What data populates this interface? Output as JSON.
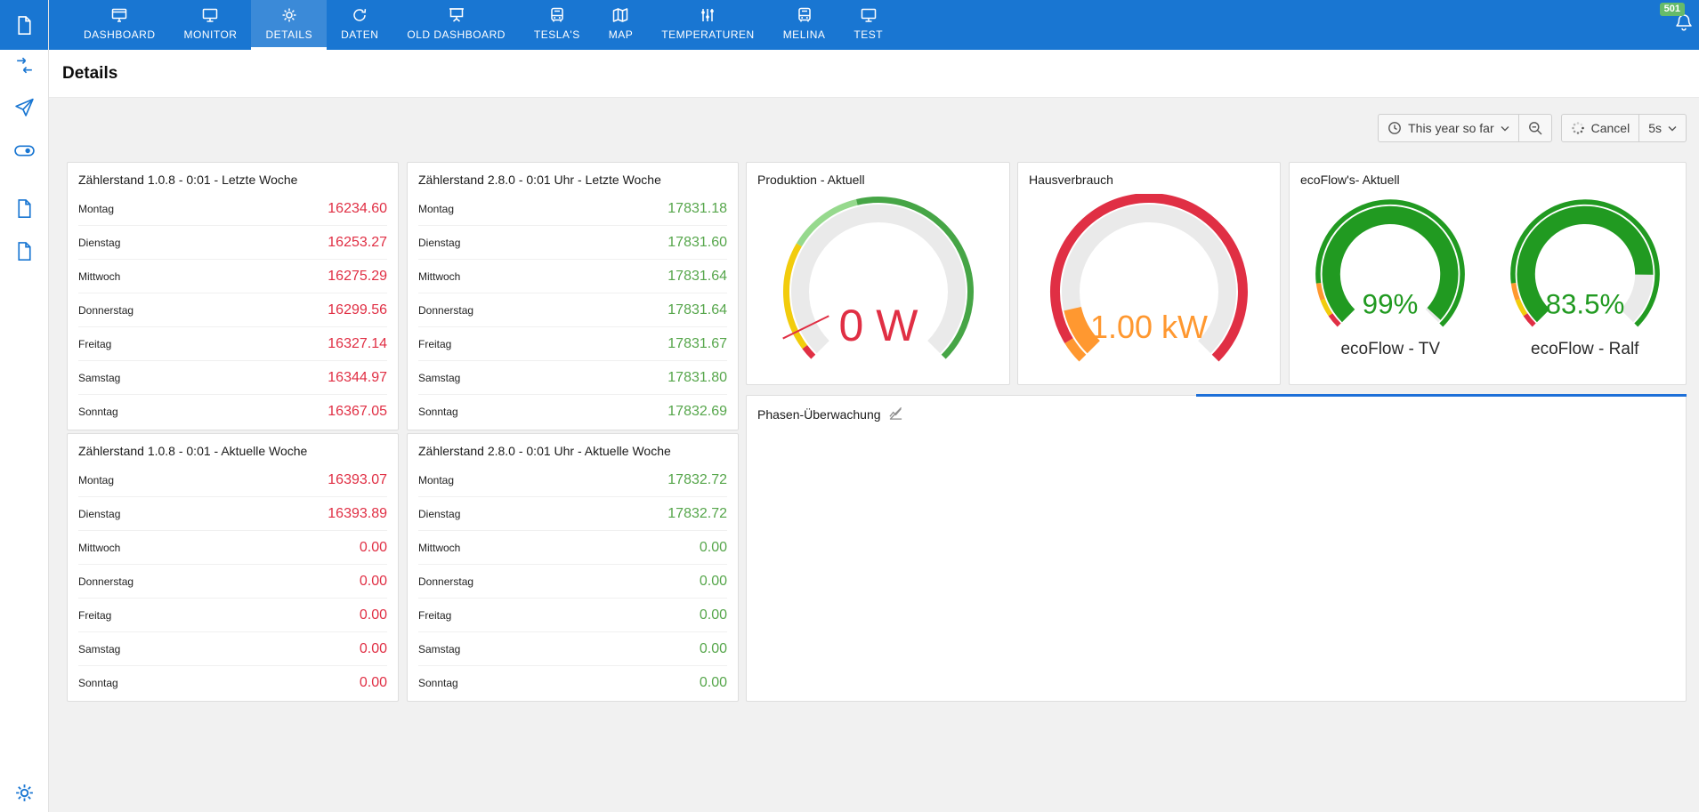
{
  "page": {
    "title": "Details"
  },
  "topnav": {
    "active_tab": "DETAILS",
    "tabs": [
      {
        "label": "DASHBOARD",
        "icon": "dashboard-icon"
      },
      {
        "label": "MONITOR",
        "icon": "monitor-icon"
      },
      {
        "label": "DETAILS",
        "icon": "gear-icon"
      },
      {
        "label": "DATEN",
        "icon": "refresh-icon"
      },
      {
        "label": "OLD DASHBOARD",
        "icon": "screen-icon"
      },
      {
        "label": "TESLA'S",
        "icon": "bus-icon"
      },
      {
        "label": "MAP",
        "icon": "map-icon"
      },
      {
        "label": "TEMPERATUREN",
        "icon": "sliders-icon"
      },
      {
        "label": "MELINA",
        "icon": "bus-icon"
      },
      {
        "label": "TEST",
        "icon": "monitor-icon"
      }
    ],
    "notification_count": "501"
  },
  "toolbar": {
    "time_range_label": "This year so far",
    "cancel_label": "Cancel",
    "refresh_interval": "5s"
  },
  "icons": {
    "sidebar": [
      "file-icon",
      "workflow-icon",
      "send-icon",
      "toggle-icon",
      "file-icon",
      "file-icon",
      "gear-icon"
    ],
    "toolbar": [
      "clock-icon",
      "zoom-out-icon",
      "spinner-icon",
      "chevron-down-icon"
    ],
    "other": [
      "bell-icon",
      "chart-slash-icon"
    ]
  },
  "colors": {
    "topbar_blue": "#1976d2",
    "value_red": "#e02f44",
    "value_green": "#56a64b",
    "gauge_green": "#219a21",
    "gauge_orange": "#ff9830",
    "gauge_yellow": "#f2cc0c",
    "badge_green": "#66bb6a"
  },
  "panels": {
    "tables": [
      {
        "title": "Zählerstand 1.0.8 - 0:01 - Letzte Woche",
        "value_color": "#e02f44",
        "rows": [
          [
            "Montag",
            "16234.60"
          ],
          [
            "Dienstag",
            "16253.27"
          ],
          [
            "Mittwoch",
            "16275.29"
          ],
          [
            "Donnerstag",
            "16299.56"
          ],
          [
            "Freitag",
            "16327.14"
          ],
          [
            "Samstag",
            "16344.97"
          ],
          [
            "Sonntag",
            "16367.05"
          ]
        ]
      },
      {
        "title": "Zählerstand 2.8.0 - 0:01 Uhr - Letzte Woche",
        "value_color": "#56a64b",
        "rows": [
          [
            "Montag",
            "17831.18"
          ],
          [
            "Dienstag",
            "17831.60"
          ],
          [
            "Mittwoch",
            "17831.64"
          ],
          [
            "Donnerstag",
            "17831.64"
          ],
          [
            "Freitag",
            "17831.67"
          ],
          [
            "Samstag",
            "17831.80"
          ],
          [
            "Sonntag",
            "17832.69"
          ]
        ]
      },
      {
        "title": "Zählerstand 1.0.8 - 0:01 - Aktuelle Woche",
        "value_color": "#e02f44",
        "rows": [
          [
            "Montag",
            "16393.07"
          ],
          [
            "Dienstag",
            "16393.89"
          ],
          [
            "Mittwoch",
            "0.00"
          ],
          [
            "Donnerstag",
            "0.00"
          ],
          [
            "Freitag",
            "0.00"
          ],
          [
            "Samstag",
            "0.00"
          ],
          [
            "Sonntag",
            "0.00"
          ]
        ]
      },
      {
        "title": "Zählerstand 2.8.0 - 0:01 Uhr - Aktuelle Woche",
        "value_color": "#56a64b",
        "rows": [
          [
            "Montag",
            "17832.72"
          ],
          [
            "Dienstag",
            "17832.72"
          ],
          [
            "Mittwoch",
            "0.00"
          ],
          [
            "Donnerstag",
            "0.00"
          ],
          [
            "Freitag",
            "0.00"
          ],
          [
            "Samstag",
            "0.00"
          ],
          [
            "Sonntag",
            "0.00"
          ]
        ]
      }
    ],
    "gauges": [
      {
        "title": "Produktion - Aktuell",
        "value_text": "0 W",
        "value_color": "#e02f44",
        "percent": 0,
        "needle_at": 0.07,
        "fill_color": "#ff9830",
        "track_color": "#eaeaea",
        "thresholds": [
          [
            0,
            0.03,
            "#e02f44"
          ],
          [
            0.03,
            0.28,
            "#f2cc0c"
          ],
          [
            0.28,
            0.45,
            "#96d98d"
          ],
          [
            0.45,
            1,
            "#46a546"
          ]
        ]
      },
      {
        "title": "Hausverbrauch",
        "value_text": "1.00 kW",
        "value_color": "#ff9830",
        "percent": 0.12,
        "fill_color": "#ff9830",
        "track_color": "#eaeaea",
        "thresholds": [
          [
            0,
            0.05,
            "#ff9830"
          ],
          [
            0.05,
            1,
            "#e02f44"
          ]
        ]
      },
      {
        "label": "ecoFlow - TV",
        "value_text": "99%",
        "value_color": "#219a21",
        "percent": 0.99,
        "fill_color": "#219a21",
        "track_color": "#eaeaea",
        "thresholds": [
          [
            0,
            0.04,
            "#e02f44"
          ],
          [
            0.04,
            0.09,
            "#f2cc0c"
          ],
          [
            0.09,
            0.14,
            "#ff9830"
          ],
          [
            0.14,
            1,
            "#219a21"
          ]
        ]
      },
      {
        "label": "ecoFlow - Ralf",
        "value_text": "83.5%",
        "value_color": "#219a21",
        "percent": 0.835,
        "fill_color": "#219a21",
        "track_color": "#eaeaea",
        "thresholds": [
          [
            0,
            0.04,
            "#e02f44"
          ],
          [
            0.04,
            0.09,
            "#f2cc0c"
          ],
          [
            0.09,
            0.14,
            "#ff9830"
          ],
          [
            0.14,
            1,
            "#219a21"
          ]
        ]
      }
    ],
    "ecoflow": {
      "title": "ecoFlow's- Aktuell"
    },
    "phasen": {
      "title": "Phasen-Überwachung"
    }
  }
}
